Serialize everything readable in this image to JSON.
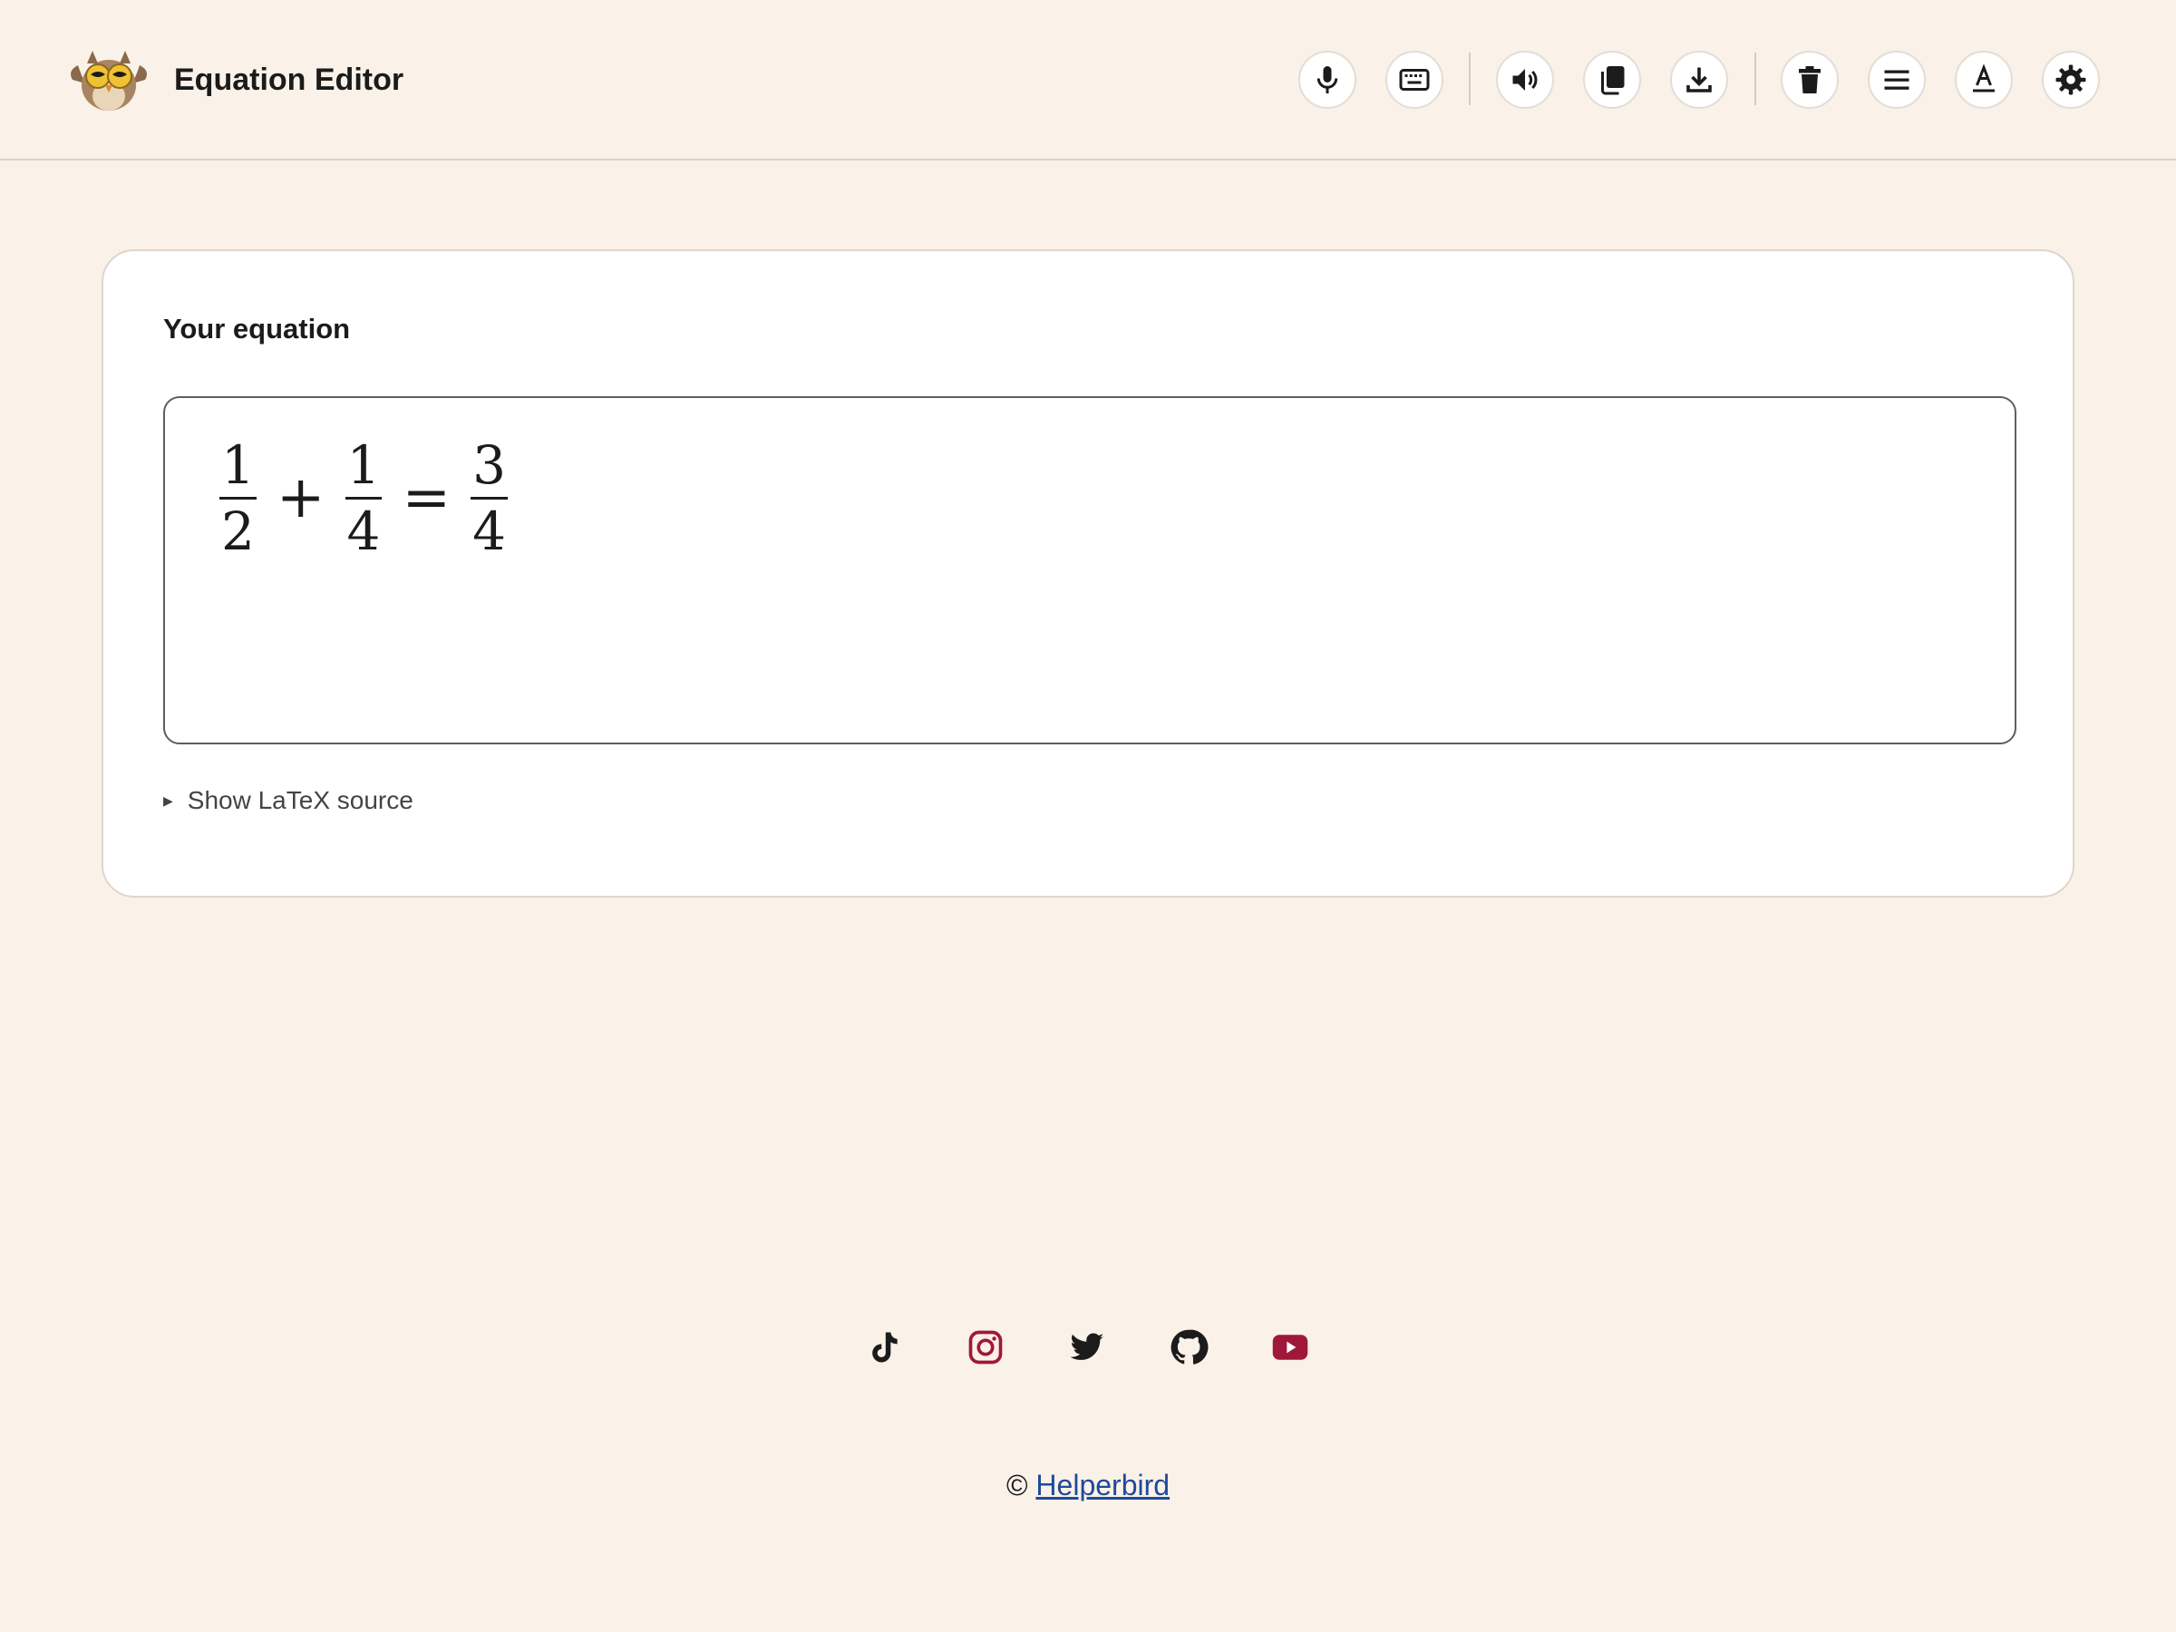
{
  "header": {
    "title": "Equation Editor",
    "toolbar": [
      {
        "name": "microphone-button",
        "icon": "microphone-icon"
      },
      {
        "name": "keyboard-button",
        "icon": "keyboard-icon"
      },
      {
        "name": "read-aloud-button",
        "icon": "speaker-icon"
      },
      {
        "name": "copy-button",
        "icon": "copy-icon"
      },
      {
        "name": "download-button",
        "icon": "download-icon"
      },
      {
        "name": "clear-button",
        "icon": "trash-icon"
      },
      {
        "name": "menu-button",
        "icon": "menu-icon"
      },
      {
        "name": "font-button",
        "icon": "font-icon"
      },
      {
        "name": "settings-button",
        "icon": "gear-icon"
      }
    ]
  },
  "card": {
    "label": "Your equation",
    "equation": {
      "terms": [
        {
          "num": "1",
          "den": "2"
        },
        {
          "op": "+"
        },
        {
          "num": "1",
          "den": "4"
        },
        {
          "op": "="
        },
        {
          "num": "3",
          "den": "4"
        }
      ]
    },
    "latex_toggle": "Show LaTeX source"
  },
  "footer": {
    "social": [
      {
        "name": "tiktok-icon",
        "color": "#1b1b1b"
      },
      {
        "name": "instagram-icon",
        "color": "#a0173c"
      },
      {
        "name": "twitter-icon",
        "color": "#1b1b1b"
      },
      {
        "name": "github-icon",
        "color": "#1b1b1b"
      },
      {
        "name": "youtube-icon",
        "color": "#a0173c"
      }
    ],
    "copyright_symbol": "©",
    "copyright_link": "Helperbird"
  },
  "colors": {
    "background": "#faf1e8",
    "accent": "#a0173c",
    "link": "#1e4a9a"
  }
}
